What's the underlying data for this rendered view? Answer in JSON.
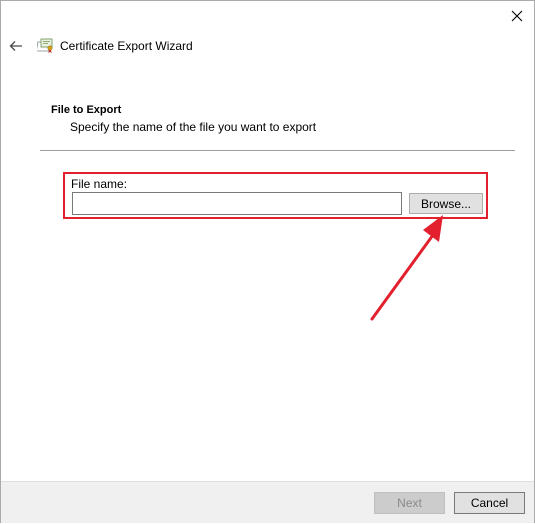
{
  "window": {
    "title": "Certificate Export Wizard",
    "close_icon": "close-icon",
    "back_icon": "back-arrow-icon",
    "app_icon": "certificate-icon"
  },
  "section": {
    "title": "File to Export",
    "subtitle": "Specify the name of the file you want to export"
  },
  "file_name": {
    "label": "File name:",
    "value": "",
    "browse_label": "Browse..."
  },
  "footer": {
    "next_label": "Next",
    "next_enabled": false,
    "cancel_label": "Cancel"
  },
  "colors": {
    "highlight": "#e3202e",
    "footer_bg": "#f0f0f0",
    "button_bg": "#e1e1e1",
    "disabled_text": "#8a8a8a"
  }
}
